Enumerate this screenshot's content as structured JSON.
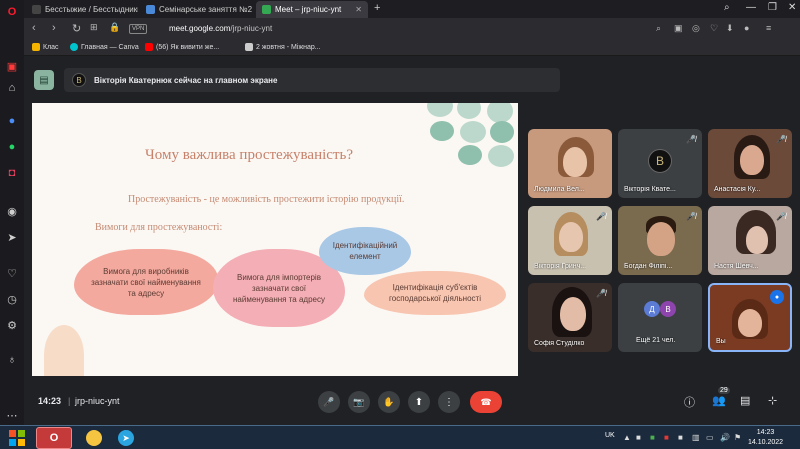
{
  "browser": {
    "tabs": [
      {
        "title": "Бесстыжие / Бесстыдники",
        "favicon_color": "#444"
      },
      {
        "title": "Семінарське заняття №2 Т",
        "favicon_color": "#4a88d8"
      },
      {
        "title": "Meet – jrp-niuc-ynt",
        "favicon_color": "#34a853"
      }
    ],
    "new_tab": "+",
    "vpn_label": "VPN",
    "url_host": "meet.google.com",
    "url_path": "/jrp-niuc-ynt",
    "bookmarks": [
      {
        "label": "Клас",
        "favicon_color": "#f4b400"
      },
      {
        "label": "Главная — Canva",
        "favicon_color": "#00c4cc"
      },
      {
        "label": "(56) Як вивити же...",
        "favicon_color": "#ff0000"
      },
      {
        "label": "2 жовтня - Міжнар...",
        "favicon_color": "#cccccc"
      }
    ]
  },
  "meet": {
    "presenter_banner": "Вікторія Кватернюк сейчас на главном экране",
    "presenter_initial": "B",
    "slide": {
      "title": "Чому важлива простежуваність?",
      "subtitle": "Простежуваність - це можливість простежити історію продукції.",
      "requirements_heading": "Вимоги для простежуваності:",
      "clouds": [
        {
          "text": "Вимога для виробників зазначати свої найменування та адресу",
          "color": "#f4a99e"
        },
        {
          "text": "Вимога для імпортерів зазначати свої найменування та адресу",
          "color": "#f4aeb5"
        },
        {
          "text": "Ідентифікаційний елемент",
          "color": "#a9c8e6"
        },
        {
          "text": "Ідентифікація суб'єктів господарської діяльності",
          "color": "#f7c5b0"
        }
      ]
    },
    "participants": [
      {
        "name": "Людмила Вел..."
      },
      {
        "name": "Вікторія Квате...",
        "initial": "B"
      },
      {
        "name": "Анастасія Ку..."
      },
      {
        "name": "Вікторія Гринч..."
      },
      {
        "name": "Богдан Філіпі..."
      },
      {
        "name": "Настя Шевч..."
      },
      {
        "name": "Софія Студілко"
      },
      {
        "name": "Ещё 21 чел.",
        "initials": [
          "Д",
          "В"
        ]
      },
      {
        "name": "Вы"
      }
    ],
    "time": "14:23",
    "separator": "|",
    "meeting_code": "jrp-niuc-ynt",
    "participants_count": "29"
  },
  "taskbar": {
    "lang": "UK",
    "time": "14:23",
    "date": "14.10.2022"
  },
  "icons": {
    "mic": "🎤",
    "camera": "📷",
    "hand": "✋",
    "present": "⬆",
    "more": "⋮",
    "end_call": "☎"
  }
}
